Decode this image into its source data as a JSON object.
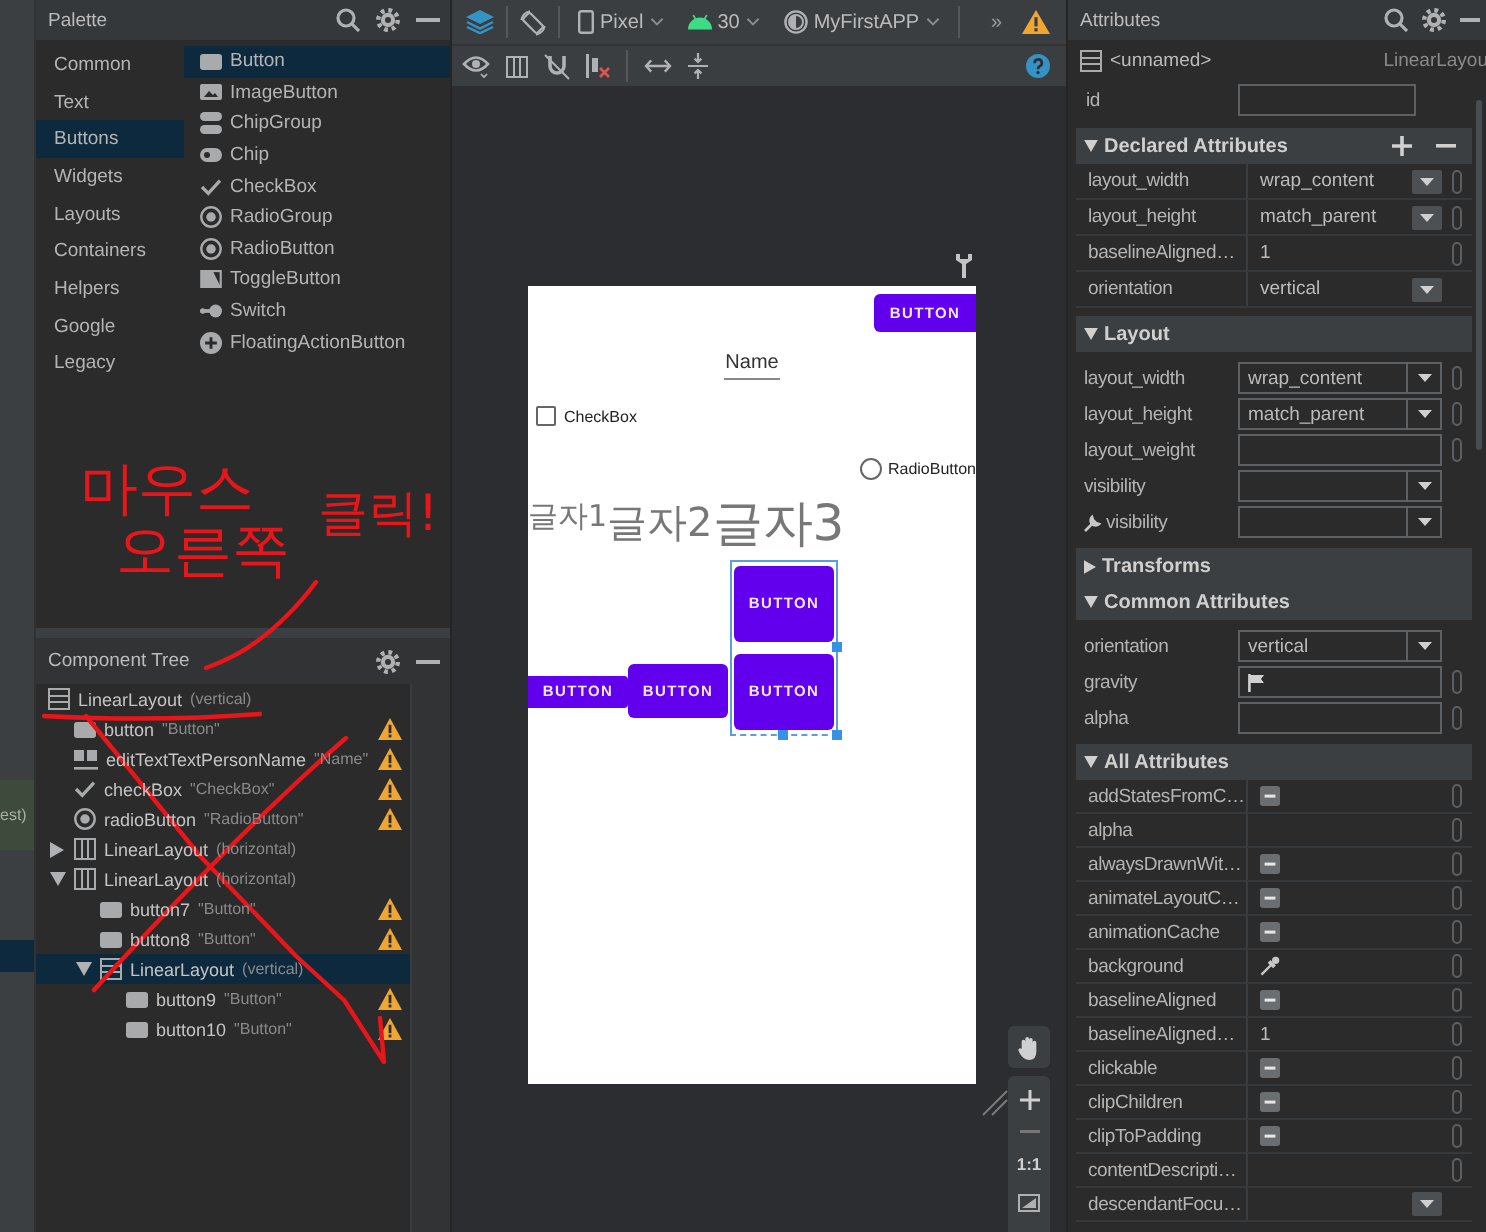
{
  "side_strip": {
    "fragment": "est)"
  },
  "palette": {
    "title": "Palette",
    "categories": [
      {
        "label": "Common",
        "selected": false
      },
      {
        "label": "Text",
        "selected": false
      },
      {
        "label": "Buttons",
        "selected": true
      },
      {
        "label": "Widgets",
        "selected": false
      },
      {
        "label": "Layouts",
        "selected": false
      },
      {
        "label": "Containers",
        "selected": false
      },
      {
        "label": "Helpers",
        "selected": false
      },
      {
        "label": "Google",
        "selected": false
      },
      {
        "label": "Legacy",
        "selected": false
      }
    ],
    "items": [
      {
        "label": "Button",
        "kind": "button",
        "selected": true
      },
      {
        "label": "ImageButton",
        "kind": "image-button",
        "selected": false
      },
      {
        "label": "ChipGroup",
        "kind": "chip-group",
        "selected": false
      },
      {
        "label": "Chip",
        "kind": "chip",
        "selected": false
      },
      {
        "label": "CheckBox",
        "kind": "checkbox",
        "selected": false
      },
      {
        "label": "RadioGroup",
        "kind": "radio",
        "selected": false
      },
      {
        "label": "RadioButton",
        "kind": "radio",
        "selected": false
      },
      {
        "label": "ToggleButton",
        "kind": "toggle",
        "selected": false
      },
      {
        "label": "Switch",
        "kind": "switch",
        "selected": false
      },
      {
        "label": "FloatingActionButton",
        "kind": "fab",
        "selected": false
      }
    ]
  },
  "annotation": {
    "text": "마우스 오른쪽 클릭!"
  },
  "component_tree": {
    "title": "Component Tree",
    "nodes": [
      {
        "name": "LinearLayout",
        "detail": "(vertical)",
        "kind": "vertical-layout",
        "selected": false,
        "warning": false,
        "children": [
          {
            "name": "button",
            "detail": "\"Button\"",
            "kind": "button",
            "selected": false,
            "warning": true
          },
          {
            "name": "editTextTextPersonName",
            "detail": "\"Name\"",
            "kind": "text-field",
            "selected": false,
            "warning": true
          },
          {
            "name": "checkBox",
            "detail": "\"CheckBox\"",
            "kind": "checkbox",
            "selected": false,
            "warning": true
          },
          {
            "name": "radioButton",
            "detail": "\"RadioButton\"",
            "kind": "radio",
            "selected": false,
            "warning": true
          },
          {
            "name": "LinearLayout",
            "detail": "(horizontal)",
            "kind": "horizontal-layout",
            "selected": false,
            "warning": false,
            "expanded": false
          },
          {
            "name": "LinearLayout",
            "detail": "(horizontal)",
            "kind": "horizontal-layout",
            "selected": false,
            "warning": false,
            "expanded": true,
            "children": [
              {
                "name": "button7",
                "detail": "\"Button\"",
                "kind": "button",
                "selected": false,
                "warning": true
              },
              {
                "name": "button8",
                "detail": "\"Button\"",
                "kind": "button",
                "selected": false,
                "warning": true
              },
              {
                "name": "LinearLayout",
                "detail": "(vertical)",
                "kind": "vertical-layout",
                "selected": true,
                "warning": false,
                "expanded": true,
                "children": [
                  {
                    "name": "button9",
                    "detail": "\"Button\"",
                    "kind": "button",
                    "selected": false,
                    "warning": true
                  },
                  {
                    "name": "button10",
                    "detail": "\"Button\"",
                    "kind": "button",
                    "selected": false,
                    "warning": true
                  }
                ]
              }
            ]
          }
        ]
      }
    ]
  },
  "toolbar": {
    "device": "Pixel",
    "api": "30",
    "theme": "MyFirstAPP",
    "overflow": "»"
  },
  "preview": {
    "top_button": "BUTTON",
    "name_field": {
      "value": "Name"
    },
    "checkbox": {
      "label": "CheckBox",
      "checked": false
    },
    "radio": {
      "label": "RadioButton",
      "checked": false
    },
    "texts": [
      "글자1",
      "글자2",
      "글자3"
    ],
    "row_buttons": [
      "BUTTON",
      "BUTTON"
    ],
    "stack": {
      "selected": true,
      "buttons": [
        "BUTTON",
        "BUTTON"
      ]
    }
  },
  "zoom": {
    "actual_size": "1:1"
  },
  "attributes": {
    "title": "Attributes",
    "component": {
      "name": "<unnamed>",
      "type": "LinearLayou"
    },
    "id_label": "id",
    "sections": [
      {
        "title": "Declared Attributes",
        "kind": "table",
        "expanded": true,
        "actions": true,
        "rows": [
          {
            "name": "layout_width",
            "value": "wrap_content",
            "kind": "dropdown",
            "picker": true
          },
          {
            "name": "layout_height",
            "value": "match_parent",
            "kind": "dropdown",
            "picker": true
          },
          {
            "name": "baselineAligned…",
            "value": "1",
            "kind": "text",
            "picker": true
          },
          {
            "name": "orientation",
            "value": "vertical",
            "kind": "dropdown",
            "picker": false
          }
        ]
      },
      {
        "title": "Layout",
        "kind": "form",
        "expanded": true,
        "actions": false,
        "rows": [
          {
            "name": "layout_width",
            "value": "wrap_content",
            "kind": "dropdown",
            "picker": true,
            "tools": false
          },
          {
            "name": "layout_height",
            "value": "match_parent",
            "kind": "dropdown",
            "picker": true,
            "tools": false
          },
          {
            "name": "layout_weight",
            "kind": "text",
            "picker": true,
            "tools": false
          },
          {
            "name": "visibility",
            "kind": "dropdown",
            "picker": false,
            "tools": false
          },
          {
            "name": "visibility",
            "kind": "dropdown",
            "picker": false,
            "tools": true
          }
        ]
      },
      {
        "title": "Transforms",
        "expanded": false,
        "actions": false
      },
      {
        "title": "Common Attributes",
        "kind": "form",
        "expanded": true,
        "actions": false,
        "rows": [
          {
            "name": "orientation",
            "value": "vertical",
            "kind": "dropdown",
            "picker": false,
            "tools": false
          },
          {
            "name": "gravity",
            "kind": "flag",
            "picker": true,
            "tools": false
          },
          {
            "name": "alpha",
            "kind": "text",
            "picker": true,
            "tools": false
          }
        ]
      },
      {
        "title": "All Attributes",
        "kind": "table",
        "expanded": true,
        "actions": false,
        "rows": [
          {
            "name": "addStatesFromC…",
            "kind": "tristate",
            "indeterminate": true,
            "picker": true
          },
          {
            "name": "alpha",
            "kind": "text",
            "picker": true
          },
          {
            "name": "alwaysDrawnWit…",
            "kind": "tristate",
            "indeterminate": true,
            "picker": true
          },
          {
            "name": "animateLayoutC…",
            "kind": "tristate",
            "indeterminate": true,
            "picker": true
          },
          {
            "name": "animationCache",
            "kind": "tristate",
            "indeterminate": true,
            "picker": true
          },
          {
            "name": "background",
            "kind": "color",
            "picker": true
          },
          {
            "name": "baselineAligned",
            "kind": "tristate",
            "indeterminate": true,
            "picker": true
          },
          {
            "name": "baselineAligned…",
            "value": "1",
            "kind": "text",
            "picker": true
          },
          {
            "name": "clickable",
            "kind": "tristate",
            "indeterminate": true,
            "picker": true
          },
          {
            "name": "clipChildren",
            "kind": "tristate",
            "indeterminate": true,
            "picker": true
          },
          {
            "name": "clipToPadding",
            "kind": "tristate",
            "indeterminate": true,
            "picker": true
          },
          {
            "name": "contentDescripti…",
            "kind": "text",
            "picker": true
          },
          {
            "name": "descendantFocu…",
            "kind": "dropdown",
            "picker": false
          }
        ]
      }
    ]
  }
}
